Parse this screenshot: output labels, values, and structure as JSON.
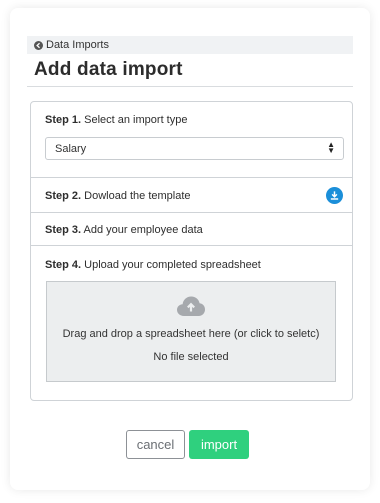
{
  "breadcrumb": {
    "label": "Data Imports",
    "icon": "arrow-left-circle-icon"
  },
  "page": {
    "title": "Add data import"
  },
  "steps": [
    {
      "num": "Step 1.",
      "text": "Select an import type"
    },
    {
      "num": "Step 2.",
      "text": "Dowload the template"
    },
    {
      "num": "Step 3.",
      "text": "Add your employee data"
    },
    {
      "num": "Step 4.",
      "text": "Upload your completed spreadsheet"
    }
  ],
  "import_type": {
    "selected": "Salary"
  },
  "dropzone": {
    "instruction": "Drag and drop a spreadsheet here (or click to seletc)",
    "status": "No file selected"
  },
  "actions": {
    "cancel_label": "cancel",
    "import_label": "import"
  },
  "colors": {
    "accent_blue": "#1b8fd9",
    "import_green": "#2fd07e"
  }
}
